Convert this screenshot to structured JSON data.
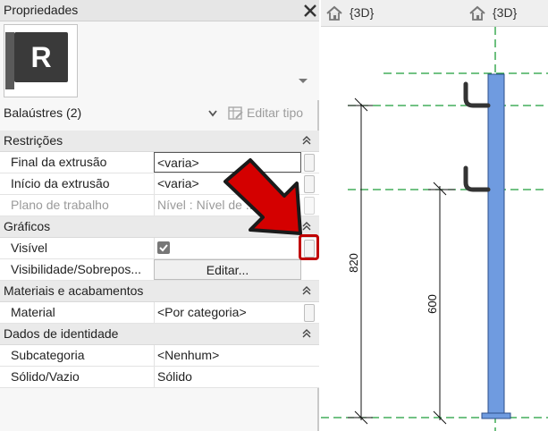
{
  "properties": {
    "title": "Propriedades",
    "type_thumbnail_letter": "R",
    "family_type": "Balaústres (2)",
    "edit_type_label": "Editar tipo",
    "sections": [
      {
        "label": "Restrições",
        "rows": [
          {
            "name": "Final da extrusão",
            "value": "<varia>",
            "style": "boxed"
          },
          {
            "name": "Início da extrusão",
            "value": "<varia>"
          },
          {
            "name": "Plano de trabalho",
            "value": "Nível : Nível de ...",
            "disabled": true
          }
        ]
      },
      {
        "label": "Gráficos",
        "rows": [
          {
            "name": "Visível",
            "checked": true
          },
          {
            "name": "Visibilidade/Sobrepos...",
            "button_label": "Editar..."
          }
        ]
      },
      {
        "label": "Materiais e acabamentos",
        "rows": [
          {
            "name": "Material",
            "value": "<Por categoria>"
          }
        ]
      },
      {
        "label": "Dados de identidade",
        "rows": [
          {
            "name": "Subcategoria",
            "value": "<Nenhum>"
          },
          {
            "name": "Sólido/Vazio",
            "value": "Sólido"
          }
        ]
      }
    ]
  },
  "viewport": {
    "tabs": [
      {
        "label": "{3D}"
      },
      {
        "label": "{3D}"
      }
    ],
    "dimensions": [
      {
        "value": "820"
      },
      {
        "value": "600"
      }
    ]
  },
  "colors": {
    "highlight": "#c00000",
    "arrow": "#d40000",
    "post_fill": "#6f9be0",
    "reference_line": "#1f9d3a"
  }
}
